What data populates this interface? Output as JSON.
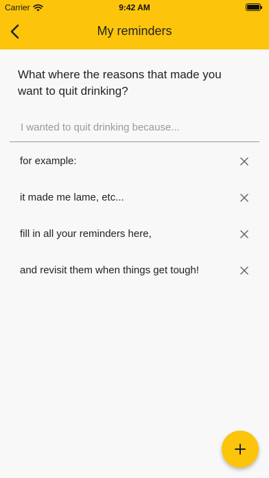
{
  "status_bar": {
    "carrier": "Carrier",
    "time": "9:42 AM"
  },
  "header": {
    "title": "My reminders",
    "back_icon": "chevron-left-icon"
  },
  "prompt": {
    "question": "What where the reasons that made you want to quit drinking?",
    "placeholder": "I wanted to quit drinking because..."
  },
  "reminders": [
    {
      "text": "for example:"
    },
    {
      "text": "it made me lame, etc..."
    },
    {
      "text": "fill in all your reminders here,"
    },
    {
      "text": "and revisit them when things get tough!"
    }
  ],
  "colors": {
    "accent": "#fcc50b",
    "background": "#f8f8f8",
    "text": "#222222"
  },
  "fab": {
    "icon": "plus-icon"
  }
}
